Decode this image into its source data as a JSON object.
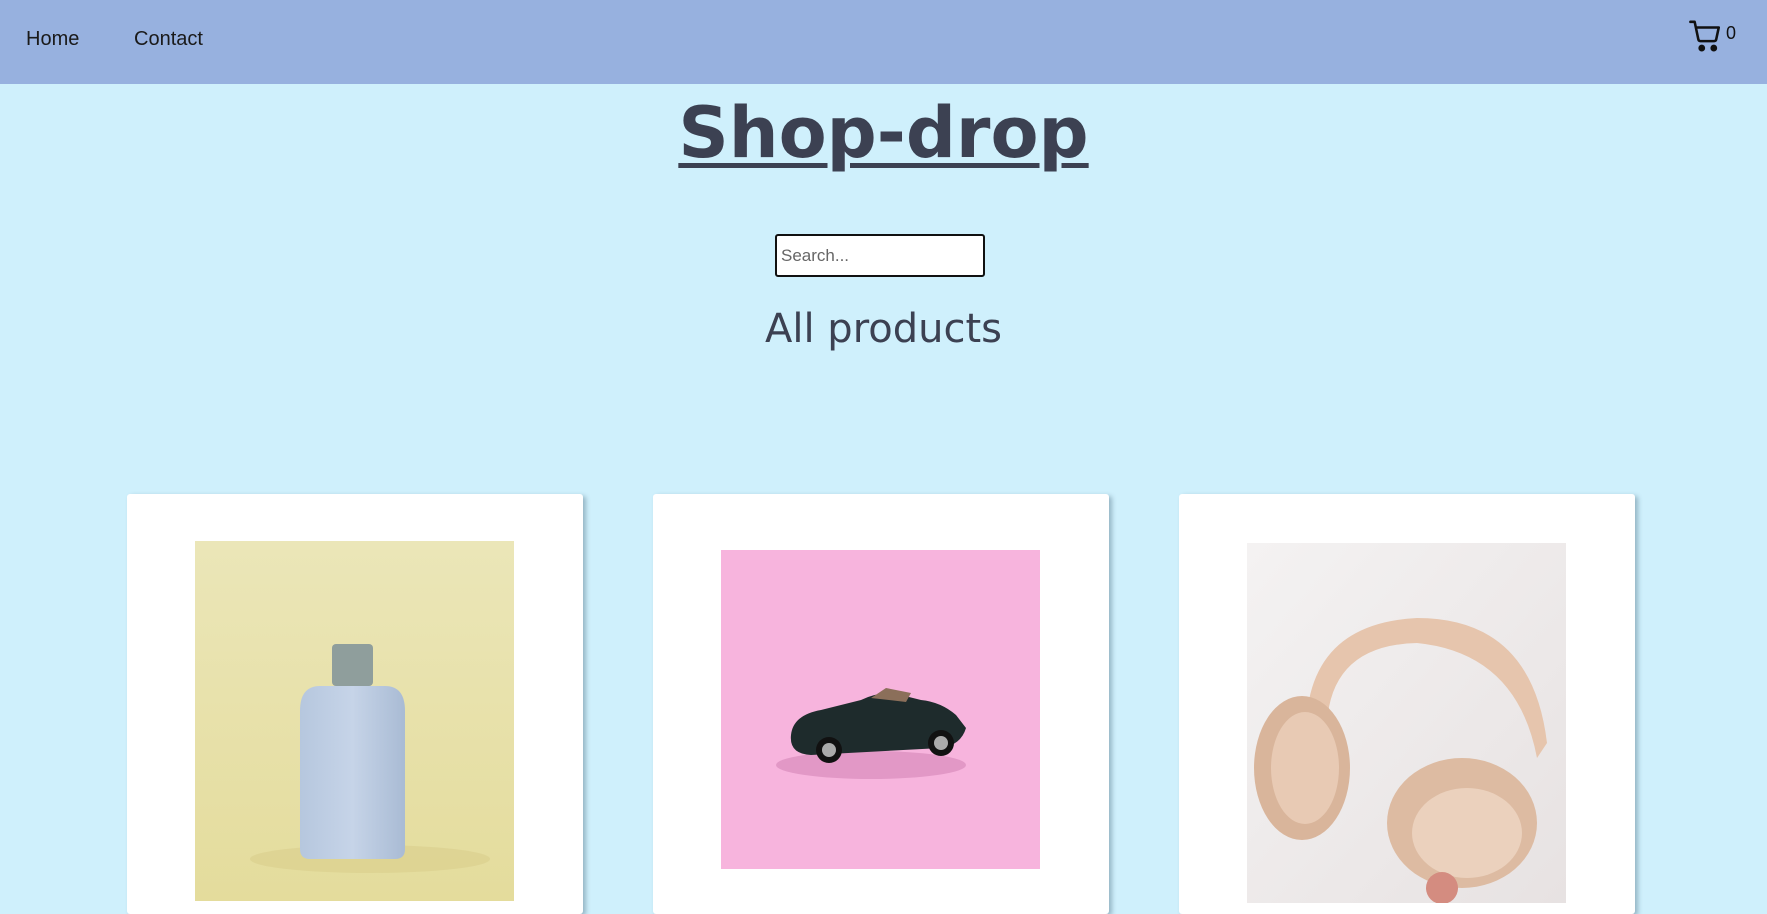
{
  "nav": {
    "home": "Home",
    "contact": "Contact"
  },
  "cart": {
    "icon": "cart-icon",
    "count": "0"
  },
  "site_title": "Shop-drop",
  "search": {
    "placeholder": "Search...",
    "value": ""
  },
  "section_title": "All products",
  "products": [
    {
      "image": "perfume-bottle-image"
    },
    {
      "image": "toy-car-image"
    },
    {
      "image": "headphones-image"
    }
  ],
  "colors": {
    "navbar": "#97b1df",
    "background": "#cff0fc",
    "title": "#3c4152"
  }
}
